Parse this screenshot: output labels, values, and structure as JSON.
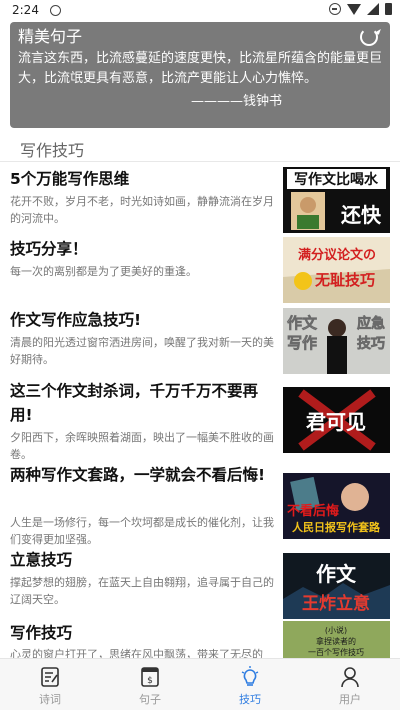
{
  "status": {
    "time": "2:24"
  },
  "quote": {
    "title": "精美句子",
    "text": "流言这东西，比流感蔓延的速度更快，比流星所蕴含的能量更巨大，比流氓更具有恶意，比流产更能让人心力憔悴。",
    "author": "————钱钟书"
  },
  "section": {
    "title": "写作技巧"
  },
  "articles": [
    {
      "title": "5个万能写作思维",
      "desc": "花开不败，岁月不老，时光如诗如画，静静流淌在岁月的河流中。",
      "thumb": {
        "line1": "写作文比喝水",
        "line2": "还快"
      }
    },
    {
      "title": "技巧分享！",
      "desc": "每一次的离别都是为了更美好的重逢。",
      "thumb": {
        "line1": "满分议论文の",
        "line2": "无耻技巧"
      }
    },
    {
      "title": "作文写作应急技巧!",
      "desc": "清晨的阳光透过窗帘洒进房间，唤醒了我对新一天的美好期待。",
      "thumb": {
        "line1": "作文",
        "line2": "写作",
        "line3": "应急",
        "line4": "技巧"
      }
    },
    {
      "title": "这三个作文封杀词，千万千万不要再用!",
      "desc": "夕阳西下，余晖映照着湖面，映出了一幅美不胜收的画卷。",
      "thumb": {
        "line1": "君可见"
      }
    },
    {
      "title": "两种写作文套路，一学就会不看后悔!",
      "desc": "人生是一场修行，每一个坎坷都是成长的催化剂，让我们变得更加坚强。",
      "thumb": {
        "line1": "不看后悔",
        "line2": "人民日报写作套路"
      }
    },
    {
      "title": "立意技巧",
      "desc": "撑起梦想的翅膀，在蓝天上自由翱翔，追寻属于自己的辽阔天空。",
      "thumb": {
        "line1": "作文",
        "line2": "王炸立意"
      }
    },
    {
      "title": "写作技巧",
      "desc": "心灵的窗户打开了，思绪在风中飘荡，带来了无尽的",
      "thumb": {
        "line1": "(小说)",
        "line2": "拿捏读者的",
        "line3": "一百个写作技巧"
      }
    }
  ],
  "nav": [
    {
      "label": "诗词",
      "icon": "poem-icon"
    },
    {
      "label": "句子",
      "icon": "sentence-icon"
    },
    {
      "label": "技巧",
      "icon": "bulb-icon"
    },
    {
      "label": "用户",
      "icon": "user-icon"
    }
  ],
  "colors": {
    "accent": "#2f7de1",
    "card": "#7a7a7a"
  }
}
